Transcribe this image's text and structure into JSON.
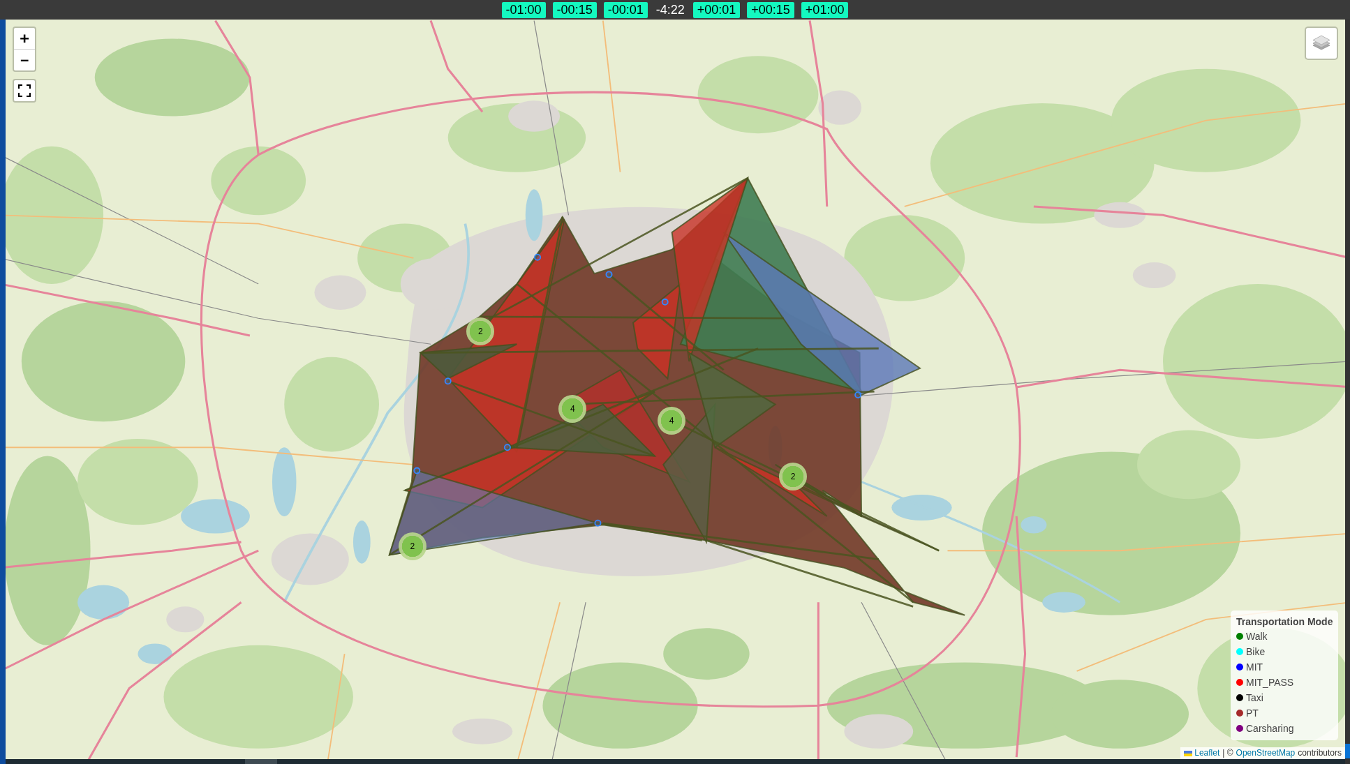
{
  "time_controls": [
    {
      "label": "-01:00",
      "kind": "step"
    },
    {
      "label": "-00:15",
      "kind": "step"
    },
    {
      "label": "-00:01",
      "kind": "step"
    },
    {
      "label": "-4:22",
      "kind": "current"
    },
    {
      "label": "+00:01",
      "kind": "step"
    },
    {
      "label": "+00:15",
      "kind": "step"
    },
    {
      "label": "+01:00",
      "kind": "step"
    }
  ],
  "map": {
    "zoom_controls": [
      {
        "label": "+",
        "kind": "zoom_in"
      },
      {
        "label": "−",
        "kind": "zoom_out"
      }
    ],
    "clusters": [
      {
        "count": "2"
      },
      {
        "count": "4"
      },
      {
        "count": "4"
      },
      {
        "count": "2"
      },
      {
        "count": "2"
      }
    ],
    "legend": {
      "title": "Transportation Mode",
      "items": [
        {
          "name": "Walk",
          "color": "#008000"
        },
        {
          "name": "Bike",
          "color": "#00ffff"
        },
        {
          "name": "MIT",
          "color": "#0000ff"
        },
        {
          "name": "MIT_PASS",
          "color": "#ff0000"
        },
        {
          "name": "Taxi",
          "color": "#000000"
        },
        {
          "name": "PT",
          "color": "#a52a2a"
        },
        {
          "name": "Carsharing",
          "color": "#800080"
        }
      ]
    },
    "attribution": [
      {
        "kind": "brand_link",
        "text": "Leaflet"
      },
      {
        "kind": "text",
        "text": "| ©"
      },
      {
        "kind": "link",
        "text": "OpenStreetMap"
      },
      {
        "kind": "text",
        "text": "contributors"
      }
    ]
  }
}
